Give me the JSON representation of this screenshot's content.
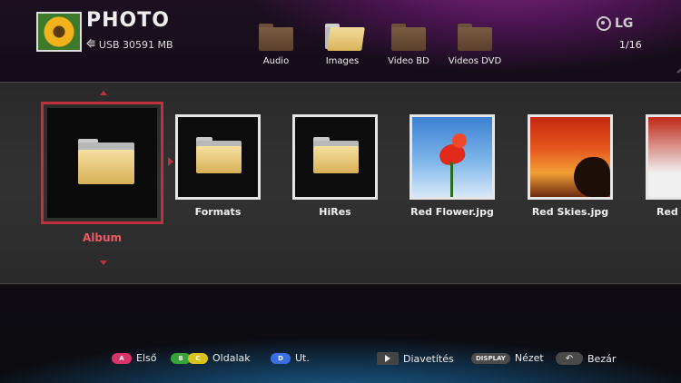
{
  "header": {
    "title": "PHOTO",
    "device": "USB 30591 MB",
    "brand": "LG",
    "page_indicator": "1/16"
  },
  "categories": [
    {
      "label": "Audio",
      "active": false
    },
    {
      "label": "Images",
      "active": true
    },
    {
      "label": "Video BD",
      "active": false
    },
    {
      "label": "Videos DVD",
      "active": false
    }
  ],
  "items": [
    {
      "label": "Album",
      "kind": "folder",
      "selected": true
    },
    {
      "label": "Formats",
      "kind": "folder"
    },
    {
      "label": "HiRes",
      "kind": "folder"
    },
    {
      "label": "Red Flower.jpg",
      "kind": "image"
    },
    {
      "label": "Red Skies.jpg",
      "kind": "image"
    },
    {
      "label": "Red S",
      "kind": "image"
    }
  ],
  "legend": {
    "first": {
      "key": "A",
      "label": "Első"
    },
    "pages": {
      "keys": [
        "B",
        "C"
      ],
      "label": "Oldalak"
    },
    "path": {
      "key": "D",
      "label": "Ut."
    },
    "slideshow": {
      "label": "Diavetítés"
    },
    "view": {
      "key": "DISPLAY",
      "label": "Nézet"
    },
    "close": {
      "label": "Bezár"
    }
  },
  "colors": {
    "selection": "#c3303d",
    "key_red": "#d8336a",
    "key_green": "#3aa23a",
    "key_yellow": "#d9c21d",
    "key_blue": "#3a6fe0"
  }
}
